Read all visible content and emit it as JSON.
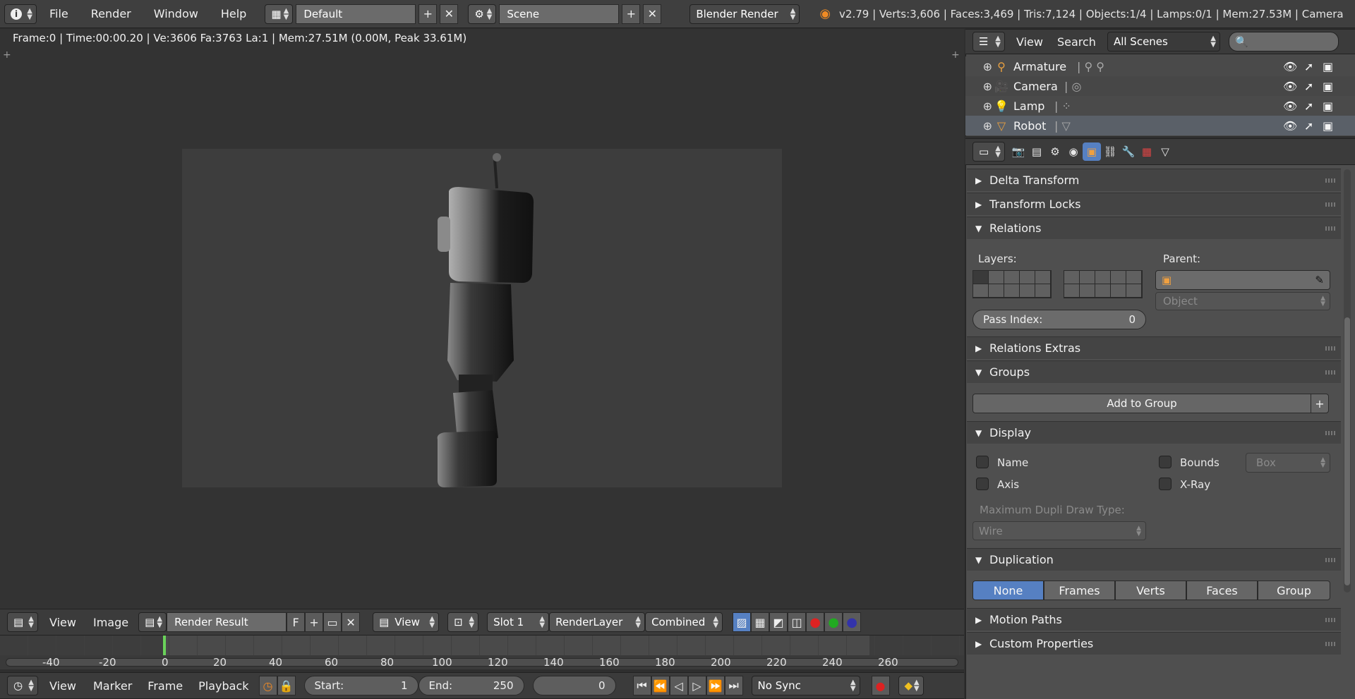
{
  "menubar": {
    "items": [
      "File",
      "Render",
      "Window",
      "Help"
    ],
    "layout_name": "Default",
    "scene_name": "Scene",
    "engine": "Blender Render",
    "stats": "v2.79 | Verts:3,606 | Faces:3,469 | Tris:7,124 | Objects:1/4 | Lamps:0/1 | Mem:27.53M | Camera"
  },
  "viewport": {
    "info": "Frame:0 | Time:00:00.20 | Ve:3606 Fa:3763 La:1 | Mem:27.51M (0.00M, Peak 33.61M)"
  },
  "image_header": {
    "view": "View",
    "image": "Image",
    "image_name": "Render Result",
    "fake_user": "F",
    "view_mode": "View",
    "slot": "Slot 1",
    "layer": "RenderLayer",
    "pass": "Combined"
  },
  "timeline": {
    "ticks": [
      "-40",
      "-20",
      "0",
      "20",
      "40",
      "60",
      "80",
      "100",
      "120",
      "140",
      "160",
      "180",
      "200",
      "220",
      "240",
      "260"
    ],
    "menu": [
      "View",
      "Marker",
      "Frame",
      "Playback"
    ],
    "start_label": "Start:",
    "start_value": "1",
    "end_label": "End:",
    "end_value": "250",
    "current_frame": "0",
    "sync": "No Sync"
  },
  "outliner": {
    "view": "View",
    "search": "Search",
    "scenes": "All Scenes",
    "rows": [
      {
        "label": "Armature",
        "color": "#e8a040"
      },
      {
        "label": "Camera",
        "color": "#e8a040"
      },
      {
        "label": "Lamp",
        "color": "#e8a040"
      },
      {
        "label": "Robot",
        "color": "#e8a040"
      }
    ]
  },
  "properties": {
    "panels": {
      "delta": "Delta Transform",
      "locks": "Transform Locks",
      "relations": "Relations",
      "relations_extras": "Relations Extras",
      "groups": "Groups",
      "display": "Display",
      "duplication": "Duplication",
      "motion": "Motion Paths",
      "custom": "Custom Properties"
    },
    "layers_label": "Layers:",
    "parent_label": "Parent:",
    "parent_type": "Object",
    "pass_index_label": "Pass Index:",
    "pass_index_value": "0",
    "add_to_group": "Add to Group",
    "display": {
      "name": "Name",
      "bounds": "Bounds",
      "bounds_type": "Box",
      "axis": "Axis",
      "xray": "X-Ray",
      "max_dupli_label": "Maximum Dupli Draw Type:",
      "max_dupli_value": "Wire"
    },
    "duplication": [
      "None",
      "Frames",
      "Verts",
      "Faces",
      "Group"
    ]
  },
  "colors": {
    "accent": "#5680c2",
    "playhead": "#6ad25a"
  }
}
